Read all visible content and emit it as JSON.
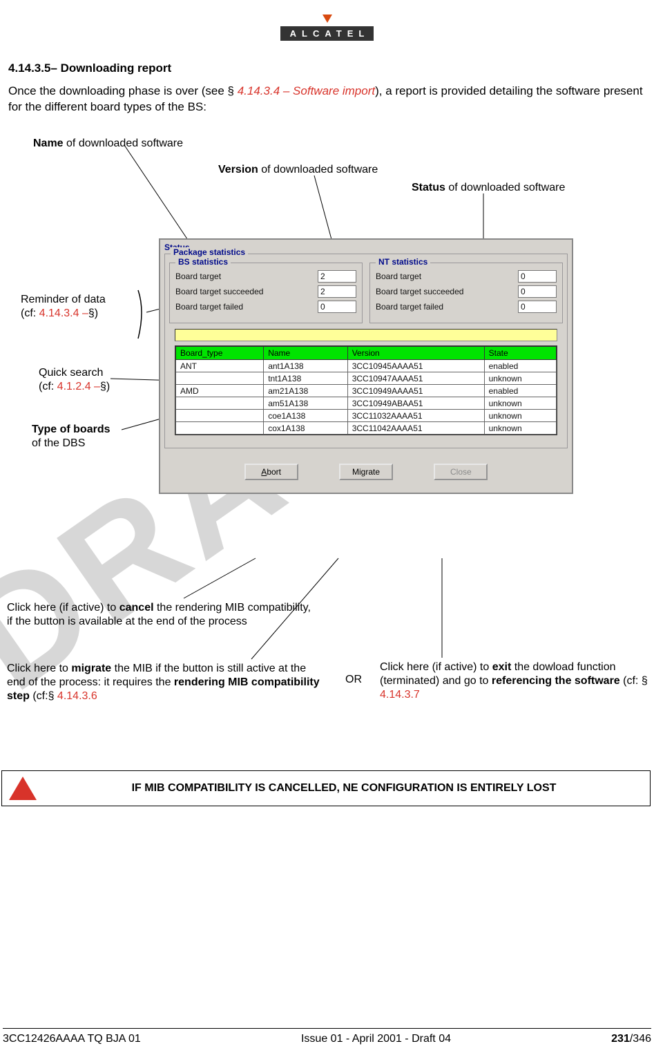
{
  "logo_text": "ALCATEL",
  "heading": "4.14.3.5– Downloading report",
  "intro_pre": "Once the downloading phase is over (see § ",
  "intro_link": "4.14.3.4 – Software import",
  "intro_post": "), a report is provided detailing the software present for the different board types of the BS:",
  "annotations": {
    "name_label_pre": "Name",
    "name_label_post": " of downloaded software",
    "version_label_pre": "Version",
    "version_label_post": " of downloaded software",
    "status_label_pre": "Status",
    "status_label_post": " of downloaded software",
    "reminder_line1": "Reminder of data",
    "reminder_line2_pre": "(cf: ",
    "reminder_ref": "4.14.3.4 –",
    "reminder_line2_post": "§)",
    "qsearch_line1": "Quick search",
    "qsearch_line2_pre": "(cf: ",
    "qsearch_ref": "4.1.2.4 –",
    "qsearch_line2_post": "§)",
    "board_type_pre": "Type of boards",
    "board_type_post": "of the DBS",
    "abort_cap_pre": "Click here (if active) to ",
    "abort_cap_b": "cancel",
    "abort_cap_post": " the rendering MIB compatibility, if the button is available at the end of the process",
    "migrate_cap_pre": "Click here to ",
    "migrate_cap_b": "migrate",
    "migrate_cap_mid": " the MIB if the button is still active at the end of the process: it requires the ",
    "migrate_cap_b2": "rendering MIB compatibility step",
    "migrate_cap_post_pre": " (cf:§ ",
    "migrate_ref": "4.14.3.6",
    "or_label": "OR",
    "close_cap_pre": "Click here (if active) to ",
    "close_cap_b": "exit",
    "close_cap_mid": " the dowload function (terminated) and go to ",
    "close_cap_b2": "referencing the software",
    "close_cap_post_pre": " (cf: § ",
    "close_ref": "4.14.3.7"
  },
  "window": {
    "status_title": "Status",
    "pkg_title": "Package statistics",
    "bs_title": "BS statistics",
    "nt_title": "NT statistics",
    "row_labels": {
      "target": "Board target",
      "succeeded": "Board target succeeded",
      "failed": "Board target failed"
    },
    "bs_vals": {
      "target": "2",
      "succeeded": "2",
      "failed": "0"
    },
    "nt_vals": {
      "target": "0",
      "succeeded": "0",
      "failed": "0"
    },
    "grid_headers": {
      "c1": "Board_type",
      "c2": "Name",
      "c3": "Version",
      "c4": "State"
    },
    "rows": [
      {
        "c1": "ANT",
        "c2": "ant1A138",
        "c3": "3CC10945AAAA51",
        "c4": "enabled"
      },
      {
        "c1": "",
        "c2": "tnt1A138",
        "c3": "3CC10947AAAA51",
        "c4": "unknown"
      },
      {
        "c1": "AMD",
        "c2": "am21A138",
        "c3": "3CC10949AAAA51",
        "c4": "enabled"
      },
      {
        "c1": "",
        "c2": "am51A138",
        "c3": "3CC10949ABAA51",
        "c4": "unknown"
      },
      {
        "c1": "",
        "c2": "coe1A138",
        "c3": "3CC11032AAAA51",
        "c4": "unknown"
      },
      {
        "c1": "",
        "c2": "cox1A138",
        "c3": "3CC11042AAAA51",
        "c4": "unknown"
      }
    ],
    "buttons": {
      "abort": "Abort",
      "migrate": "Migrate",
      "close": "Close"
    }
  },
  "watermark": "DRAFT",
  "warning": "IF MIB COMPATIBILITY IS CANCELLED, NE CONFIGURATION IS ENTIRELY LOST",
  "footer": {
    "left": "3CC12426AAAA TQ BJA 01",
    "center": "Issue 01 - April 2001 - Draft 04",
    "right_a": "231",
    "right_b": "/346"
  }
}
